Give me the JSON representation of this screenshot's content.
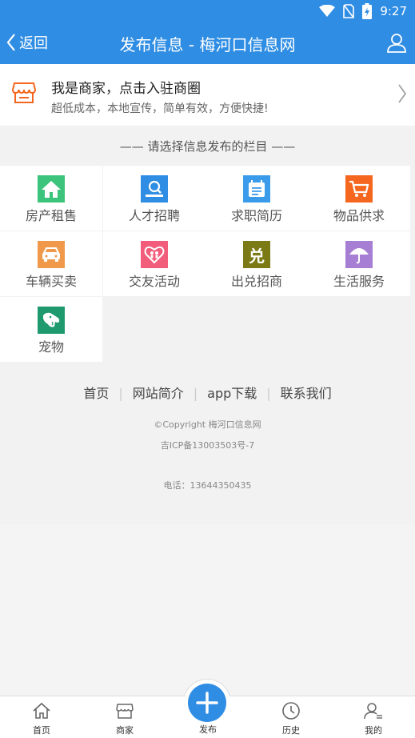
{
  "status": {
    "time": "9:27"
  },
  "navbar": {
    "back_label": "返回",
    "title": "发布信息 - 梅河口信息网"
  },
  "merchant": {
    "title": "我是商家，点击入驻商圈",
    "subtitle": "超低成本，本地宣传，简单有效，方便快捷!"
  },
  "section_title": "—— 请选择信息发布的栏目 ——",
  "categories": [
    {
      "label": "房产租售",
      "icon": "house-icon",
      "color": "#3cc47c"
    },
    {
      "label": "人才招聘",
      "icon": "person-search-icon",
      "color": "#2f8de4"
    },
    {
      "label": "求职简历",
      "icon": "calendar-list-icon",
      "color": "#3a9bea"
    },
    {
      "label": "物品供求",
      "icon": "cart-icon",
      "color": "#f5661e"
    },
    {
      "label": "车辆买卖",
      "icon": "car-icon",
      "color": "#f0994a"
    },
    {
      "label": "交友活动",
      "icon": "heart-people-icon",
      "color": "#f25d7c"
    },
    {
      "label": "出兑招商",
      "icon": "dui-char-icon",
      "color": "#7b7a15",
      "char": "兑"
    },
    {
      "label": "生活服务",
      "icon": "umbrella-icon",
      "color": "#a67fd4"
    },
    {
      "label": "宠物",
      "icon": "dog-icon",
      "color": "#1e9a6e"
    }
  ],
  "footer": {
    "links": [
      "首页",
      "网站简介",
      "app下载",
      "联系我们"
    ],
    "copyright": "©Copyright  梅河口信息网",
    "icp": "吉ICP备13003503号-7",
    "phone": "电话：13644350435"
  },
  "tabbar": {
    "items": [
      {
        "label": "首页",
        "icon": "home-icon"
      },
      {
        "label": "商家",
        "icon": "shop-icon"
      },
      {
        "label": "发布",
        "icon": "plus-icon"
      },
      {
        "label": "历史",
        "icon": "clock-icon"
      },
      {
        "label": "我的",
        "icon": "user-icon"
      }
    ]
  },
  "colors": {
    "primary": "#2f8de4",
    "merchant_icon": "#f5661e"
  }
}
